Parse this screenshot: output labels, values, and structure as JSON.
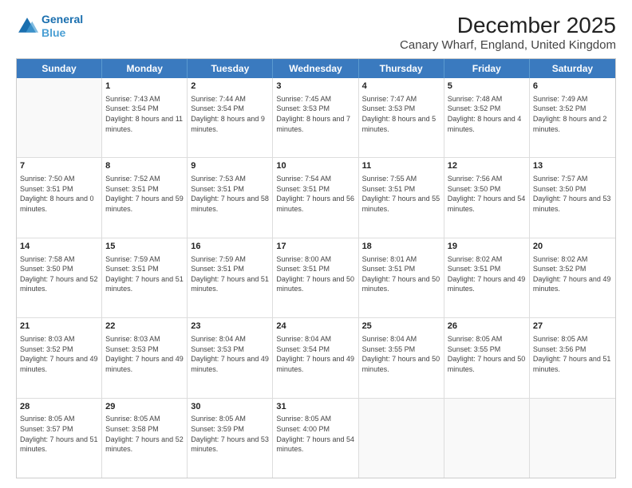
{
  "header": {
    "logo_line1": "General",
    "logo_line2": "Blue",
    "title": "December 2025",
    "subtitle": "Canary Wharf, England, United Kingdom"
  },
  "days_of_week": [
    "Sunday",
    "Monday",
    "Tuesday",
    "Wednesday",
    "Thursday",
    "Friday",
    "Saturday"
  ],
  "weeks": [
    [
      {
        "day": "",
        "sunrise": "",
        "sunset": "",
        "daylight": "",
        "empty": true
      },
      {
        "day": "1",
        "sunrise": "7:43 AM",
        "sunset": "3:54 PM",
        "daylight": "8 hours and 11 minutes."
      },
      {
        "day": "2",
        "sunrise": "7:44 AM",
        "sunset": "3:54 PM",
        "daylight": "8 hours and 9 minutes."
      },
      {
        "day": "3",
        "sunrise": "7:45 AM",
        "sunset": "3:53 PM",
        "daylight": "8 hours and 7 minutes."
      },
      {
        "day": "4",
        "sunrise": "7:47 AM",
        "sunset": "3:53 PM",
        "daylight": "8 hours and 5 minutes."
      },
      {
        "day": "5",
        "sunrise": "7:48 AM",
        "sunset": "3:52 PM",
        "daylight": "8 hours and 4 minutes."
      },
      {
        "day": "6",
        "sunrise": "7:49 AM",
        "sunset": "3:52 PM",
        "daylight": "8 hours and 2 minutes."
      }
    ],
    [
      {
        "day": "7",
        "sunrise": "7:50 AM",
        "sunset": "3:51 PM",
        "daylight": "8 hours and 0 minutes."
      },
      {
        "day": "8",
        "sunrise": "7:52 AM",
        "sunset": "3:51 PM",
        "daylight": "7 hours and 59 minutes."
      },
      {
        "day": "9",
        "sunrise": "7:53 AM",
        "sunset": "3:51 PM",
        "daylight": "7 hours and 58 minutes."
      },
      {
        "day": "10",
        "sunrise": "7:54 AM",
        "sunset": "3:51 PM",
        "daylight": "7 hours and 56 minutes."
      },
      {
        "day": "11",
        "sunrise": "7:55 AM",
        "sunset": "3:51 PM",
        "daylight": "7 hours and 55 minutes."
      },
      {
        "day": "12",
        "sunrise": "7:56 AM",
        "sunset": "3:50 PM",
        "daylight": "7 hours and 54 minutes."
      },
      {
        "day": "13",
        "sunrise": "7:57 AM",
        "sunset": "3:50 PM",
        "daylight": "7 hours and 53 minutes."
      }
    ],
    [
      {
        "day": "14",
        "sunrise": "7:58 AM",
        "sunset": "3:50 PM",
        "daylight": "7 hours and 52 minutes."
      },
      {
        "day": "15",
        "sunrise": "7:59 AM",
        "sunset": "3:51 PM",
        "daylight": "7 hours and 51 minutes."
      },
      {
        "day": "16",
        "sunrise": "7:59 AM",
        "sunset": "3:51 PM",
        "daylight": "7 hours and 51 minutes."
      },
      {
        "day": "17",
        "sunrise": "8:00 AM",
        "sunset": "3:51 PM",
        "daylight": "7 hours and 50 minutes."
      },
      {
        "day": "18",
        "sunrise": "8:01 AM",
        "sunset": "3:51 PM",
        "daylight": "7 hours and 50 minutes."
      },
      {
        "day": "19",
        "sunrise": "8:02 AM",
        "sunset": "3:51 PM",
        "daylight": "7 hours and 49 minutes."
      },
      {
        "day": "20",
        "sunrise": "8:02 AM",
        "sunset": "3:52 PM",
        "daylight": "7 hours and 49 minutes."
      }
    ],
    [
      {
        "day": "21",
        "sunrise": "8:03 AM",
        "sunset": "3:52 PM",
        "daylight": "7 hours and 49 minutes."
      },
      {
        "day": "22",
        "sunrise": "8:03 AM",
        "sunset": "3:53 PM",
        "daylight": "7 hours and 49 minutes."
      },
      {
        "day": "23",
        "sunrise": "8:04 AM",
        "sunset": "3:53 PM",
        "daylight": "7 hours and 49 minutes."
      },
      {
        "day": "24",
        "sunrise": "8:04 AM",
        "sunset": "3:54 PM",
        "daylight": "7 hours and 49 minutes."
      },
      {
        "day": "25",
        "sunrise": "8:04 AM",
        "sunset": "3:55 PM",
        "daylight": "7 hours and 50 minutes."
      },
      {
        "day": "26",
        "sunrise": "8:05 AM",
        "sunset": "3:55 PM",
        "daylight": "7 hours and 50 minutes."
      },
      {
        "day": "27",
        "sunrise": "8:05 AM",
        "sunset": "3:56 PM",
        "daylight": "7 hours and 51 minutes."
      }
    ],
    [
      {
        "day": "28",
        "sunrise": "8:05 AM",
        "sunset": "3:57 PM",
        "daylight": "7 hours and 51 minutes."
      },
      {
        "day": "29",
        "sunrise": "8:05 AM",
        "sunset": "3:58 PM",
        "daylight": "7 hours and 52 minutes."
      },
      {
        "day": "30",
        "sunrise": "8:05 AM",
        "sunset": "3:59 PM",
        "daylight": "7 hours and 53 minutes."
      },
      {
        "day": "31",
        "sunrise": "8:05 AM",
        "sunset": "4:00 PM",
        "daylight": "7 hours and 54 minutes."
      },
      {
        "day": "",
        "sunrise": "",
        "sunset": "",
        "daylight": "",
        "empty": true
      },
      {
        "day": "",
        "sunrise": "",
        "sunset": "",
        "daylight": "",
        "empty": true
      },
      {
        "day": "",
        "sunrise": "",
        "sunset": "",
        "daylight": "",
        "empty": true
      }
    ]
  ]
}
